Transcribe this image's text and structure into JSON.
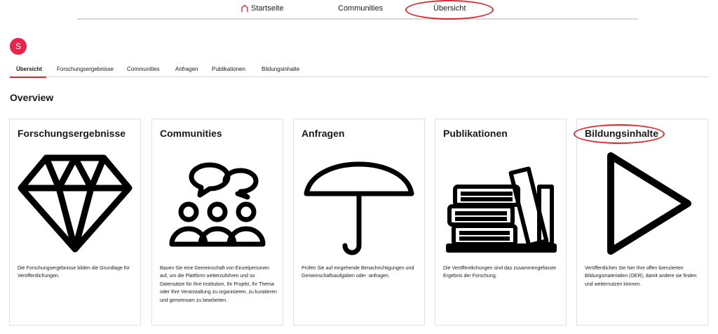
{
  "topnav": {
    "items": [
      {
        "label": "Startseite",
        "icon": "home-icon"
      },
      {
        "label": "Communities"
      },
      {
        "label": "Übersicht"
      }
    ]
  },
  "avatar": {
    "initial": "S"
  },
  "subtabs": [
    {
      "label": "Übersicht",
      "active": true
    },
    {
      "label": "Forschungsergebnisse"
    },
    {
      "label": "Communities"
    },
    {
      "label": "Anfragen"
    },
    {
      "label": "Publikationen"
    },
    {
      "label": "Bildungsinhalte"
    }
  ],
  "section": {
    "title": "Overview"
  },
  "cards": [
    {
      "title": "Forschungsergebnisse",
      "icon": "diamond-icon",
      "desc": "Die Forschungsergebnisse bilden die Grundlage für Veröffentlichungen."
    },
    {
      "title": "Communities",
      "icon": "community-people-icon",
      "desc": "Bauen Sie eine Gemeinschaft von Einzelpersonen auf, um die Plattform weiterzuführen und so Datensätze für Ihre Institution, Ihr Projekt, Ihr Thema oder Ihre Veranstaltung zu organisieren, zu kuratieren und gemeinsam zu bearbeiten."
    },
    {
      "title": "Anfragen",
      "icon": "umbrella-icon",
      "desc": "Prüfen Sie auf eingehende Benachrichtigungen und Gemeinschaftsaufgaben oder -anfragen."
    },
    {
      "title": "Publikationen",
      "icon": "books-icon",
      "desc": "Die Veröffentlichungen sind das zusammengefasste Ergebnis der Forschung."
    },
    {
      "title": "Bildungsinhalte",
      "icon": "play-icon",
      "desc": "Veröffentlichen Sie hier Ihre offen lizenzierten Bildungsmaterialien (OER), damit andere sie finden und weiternutzen können."
    }
  ],
  "colors": {
    "accent": "#e0262c",
    "avatar": "#e5244f",
    "annotation": "#e0262c"
  }
}
